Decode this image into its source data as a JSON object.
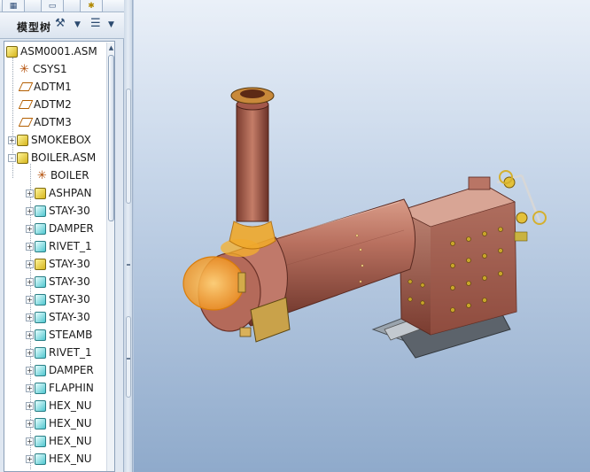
{
  "panel": {
    "title": "模型树"
  },
  "tree": {
    "rows": [
      {
        "label": "ASM0001.ASM",
        "icon": "assembly-icon",
        "expander": ""
      },
      {
        "label": "CSYS1",
        "icon": "csys-icon",
        "expander": ""
      },
      {
        "label": "ADTM1",
        "icon": "datum-plane-icon",
        "expander": ""
      },
      {
        "label": "ADTM2",
        "icon": "datum-plane-icon",
        "expander": ""
      },
      {
        "label": "ADTM3",
        "icon": "datum-plane-icon",
        "expander": ""
      },
      {
        "label": "SMOKEBOX",
        "icon": "assembly-icon",
        "expander": "+"
      },
      {
        "label": "BOILER.ASM",
        "icon": "assembly-icon",
        "expander": "-"
      },
      {
        "label": "BOILER",
        "icon": "csys-icon",
        "expander": ""
      },
      {
        "label": "ASHPAN",
        "icon": "assembly-icon",
        "expander": "+"
      },
      {
        "label": "STAY-30",
        "icon": "part-icon",
        "expander": "+"
      },
      {
        "label": "DAMPER",
        "icon": "part-icon",
        "expander": "+"
      },
      {
        "label": "RIVET_1",
        "icon": "part-icon",
        "expander": "+"
      },
      {
        "label": "STAY-30",
        "icon": "assembly-icon",
        "expander": "+"
      },
      {
        "label": "STAY-30",
        "icon": "part-icon",
        "expander": "+"
      },
      {
        "label": "STAY-30",
        "icon": "part-icon",
        "expander": "+"
      },
      {
        "label": "STAY-30",
        "icon": "part-icon",
        "expander": "+"
      },
      {
        "label": "STEAMB",
        "icon": "part-icon",
        "expander": "+"
      },
      {
        "label": "RIVET_1",
        "icon": "part-icon",
        "expander": "+"
      },
      {
        "label": "DAMPER",
        "icon": "part-icon",
        "expander": "+"
      },
      {
        "label": "FLAPHIN",
        "icon": "part-icon",
        "expander": "+"
      },
      {
        "label": "HEX_NU",
        "icon": "part-icon",
        "expander": "+"
      },
      {
        "label": "HEX_NU",
        "icon": "part-icon",
        "expander": "+"
      },
      {
        "label": "HEX_NU",
        "icon": "part-icon",
        "expander": "+"
      },
      {
        "label": "HEX_NU",
        "icon": "part-icon",
        "expander": "+"
      }
    ]
  },
  "colors": {
    "boiler_body": "#b8705f",
    "highlight": "#f5a21a",
    "background_top": "#eaf0f8",
    "background_bottom": "#8faacb"
  }
}
